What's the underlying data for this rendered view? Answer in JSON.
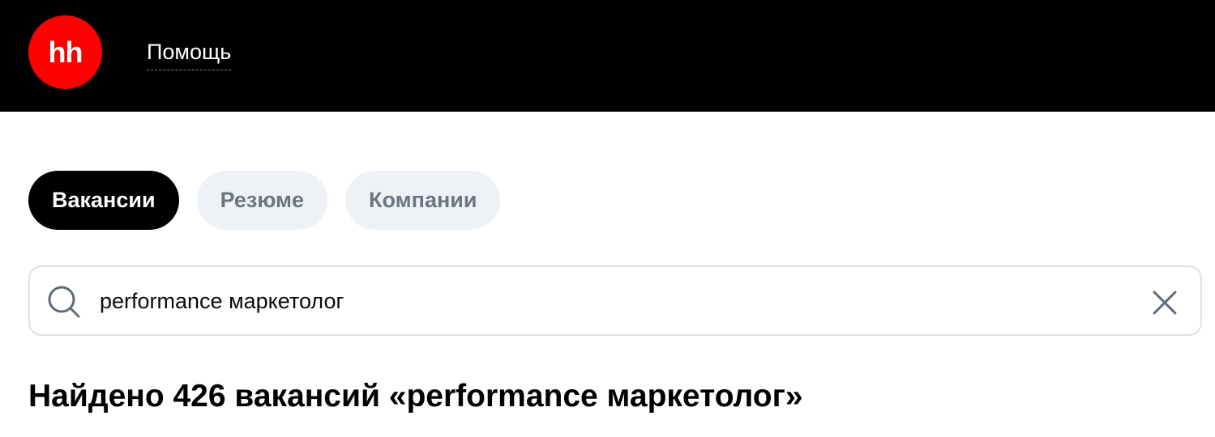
{
  "header": {
    "logo_text": "hh",
    "help_label": "Помощь"
  },
  "tabs": [
    {
      "label": "Вакансии",
      "active": true
    },
    {
      "label": "Резюме",
      "active": false
    },
    {
      "label": "Компании",
      "active": false
    }
  ],
  "search": {
    "value": "performance маркетолог",
    "search_icon": "search-icon",
    "clear_icon": "close-icon"
  },
  "results": {
    "title": "Найдено 426 вакансий «performance маркетолог»"
  },
  "colors": {
    "brand": "#ff0000",
    "header_bg": "#000000",
    "tab_inactive_bg": "#eef1f6",
    "tab_inactive_text": "#6b7683"
  }
}
